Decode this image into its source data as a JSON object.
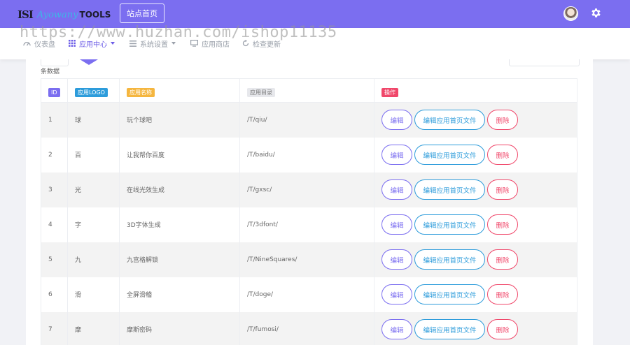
{
  "header": {
    "logo_mark": "ISI",
    "logo_script": "Ayowany",
    "logo_tools": "TOOLS",
    "home_button": "站点首页",
    "user_icon": "user-avatar",
    "settings_icon": "gear-icon"
  },
  "nav": {
    "items": [
      {
        "label": "仪表盘",
        "icon": "speedometer-icon",
        "has_caret": false
      },
      {
        "label": "应用中心",
        "icon": "grid-icon",
        "has_caret": true,
        "active": true
      },
      {
        "label": "系统设置",
        "icon": "list-icon",
        "has_caret": true
      },
      {
        "label": "应用商店",
        "icon": "monitor-icon",
        "has_caret": false
      },
      {
        "label": "检查更新",
        "icon": "refresh-icon",
        "has_caret": false
      }
    ]
  },
  "watermark": "https://www.huzhan.com/ishop11135",
  "records_label": "条数据",
  "table": {
    "headers": [
      "ID",
      "应用LOGO",
      "应用名称",
      "应用目录",
      "操作"
    ],
    "rows": [
      {
        "id": "1",
        "logo": "球",
        "name": "玩个球吧",
        "dir": "/T/qiu/"
      },
      {
        "id": "2",
        "logo": "百",
        "name": "让我帮你百度",
        "dir": "/T/baidu/"
      },
      {
        "id": "3",
        "logo": "光",
        "name": "在线光效生成",
        "dir": "/T/gxsc/"
      },
      {
        "id": "4",
        "logo": "字",
        "name": "3D字体生成",
        "dir": "/T/3dfont/"
      },
      {
        "id": "5",
        "logo": "九",
        "name": "九宫格解锁",
        "dir": "/T/NineSquares/"
      },
      {
        "id": "6",
        "logo": "滑",
        "name": "全屏滑稽",
        "dir": "/T/doge/"
      },
      {
        "id": "7",
        "logo": "摩",
        "name": "摩斯密码",
        "dir": "/T/fumosi/"
      }
    ],
    "actions": {
      "edit": "编辑",
      "edit_home": "编辑应用首页文件",
      "delete": "删除"
    }
  },
  "colors": {
    "primary": "#7b6ef0",
    "info": "#2d9cdb",
    "warning": "#f5b63f",
    "danger": "#f0476a"
  }
}
